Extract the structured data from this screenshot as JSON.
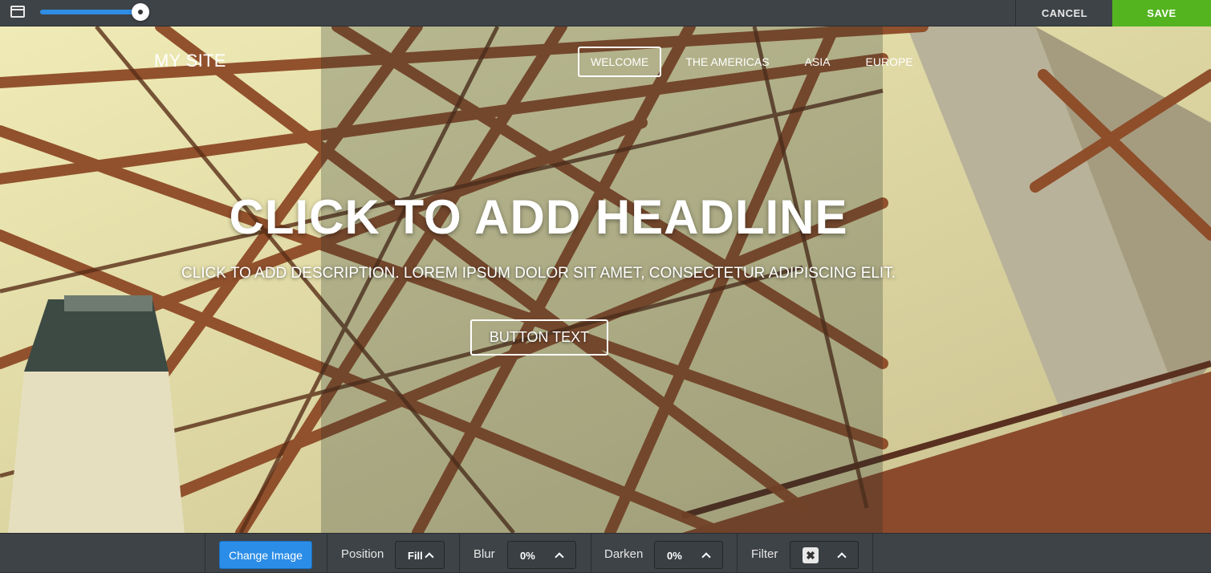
{
  "topbar": {
    "window_icon": "window-icon",
    "zoom_slider_value": 1.0,
    "cancel_label": "CANCEL",
    "save_label": "SAVE",
    "save_color": "#54b41f"
  },
  "site": {
    "title": "MY SITE",
    "nav": [
      "WELCOME",
      "THE AMERICAS",
      "ASIA",
      "EUROPE"
    ],
    "active_nav": "WELCOME"
  },
  "hero": {
    "headline": "CLICK TO ADD HEADLINE",
    "description": "CLICK TO ADD DESCRIPTION. LOREM IPSUM DOLOR SIT AMET, CONSECTETUR ADIPISCING ELIT.",
    "button_label": "BUTTON TEXT"
  },
  "toolbar": {
    "change_image_label": "Change Image",
    "position_label": "Position",
    "position_value": "Fill",
    "blur_label": "Blur",
    "blur_value": "0%",
    "darken_label": "Darken",
    "darken_value": "0%",
    "filter_label": "Filter",
    "filter_icon": "x-icon",
    "accent_color": "#2b8de8"
  }
}
